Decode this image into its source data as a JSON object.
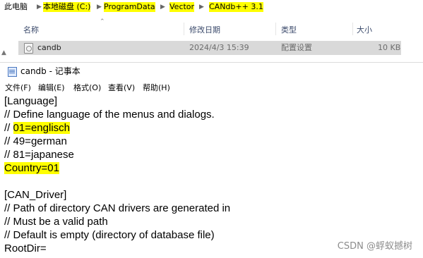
{
  "breadcrumb": {
    "items": [
      "此电脑",
      "本地磁盘 (C:)",
      "ProgramData",
      "Vector",
      "CANdb++ 3.1"
    ]
  },
  "columns": {
    "name": "名称",
    "modified": "修改日期",
    "type": "类型",
    "size": "大小"
  },
  "file": {
    "name": "candb",
    "modified": "2024/4/3 15:39",
    "type": "配置设置",
    "size": "10 KB"
  },
  "notepad": {
    "title": "candb - 记事本",
    "menu": [
      "文件(F)",
      "编辑(E)",
      "格式(O)",
      "查看(V)",
      "帮助(H)"
    ],
    "lines": [
      "[Language]",
      "// Define language of the menus and dialogs.",
      "01=englisch",
      "// 49=german",
      "// 81=japanese",
      "Country=01",
      "[CAN_Driver]",
      "// Path of directory CAN drivers are generated in",
      "// Must be a valid path",
      "// Default is empty (directory of database file)",
      "RootDir="
    ],
    "comment_prefix": "// "
  },
  "watermark": "CSDN @蜉蚁撼树",
  "colors": {
    "highlight": "#ffff00",
    "selected_row": "#d9d9d9"
  }
}
